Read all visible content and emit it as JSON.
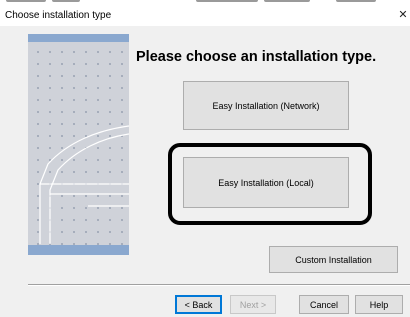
{
  "window": {
    "title": "Choose installation type",
    "close_glyph": "✕"
  },
  "main": {
    "heading": "Please choose an installation type.",
    "options": {
      "network_label": "Easy Installation (Network)",
      "local_label": "Easy Installation (Local)",
      "custom_label": "Custom Installation"
    }
  },
  "footer": {
    "back_label": "< Back",
    "next_label": "Next >",
    "cancel_label": "Cancel",
    "help_label": "Help"
  },
  "colors": {
    "banner_band": "#8aa8cf",
    "highlight_outline": "#000000",
    "default_button_border": "#0078d7"
  },
  "icons": {
    "close": "close-icon",
    "banner": "printer-illustration"
  }
}
